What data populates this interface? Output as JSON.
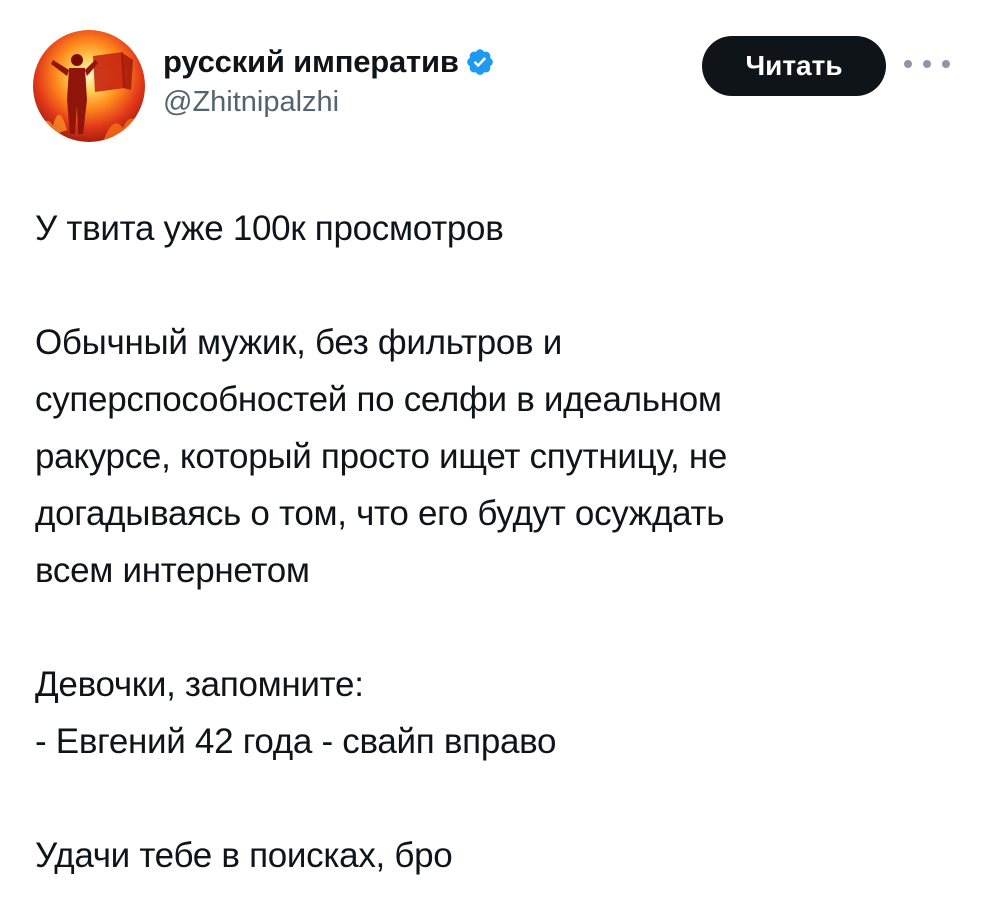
{
  "author": {
    "display_name": "русский императив",
    "handle": "@Zhitnipalzhi",
    "avatar_icon": "avatar-image",
    "verified_icon": "verified-badge-icon",
    "verified_color": "#1d9bf0"
  },
  "actions": {
    "follow_label": "Читать",
    "more_icon": "more-options-icon"
  },
  "tweet": {
    "lines": [
      "У твита уже 100к просмотров",
      "Обычный мужик, без фильтров и",
      "суперспособностей по селфи в идеальном",
      "ракурсе, который просто ищет спутницу, не",
      "догадываясь о том, что его будут осуждать",
      "всем интернетом",
      "Девочки, запомните:",
      "- Евгений 42 года - свайп вправо",
      "Удачи тебе в поисках, бро"
    ]
  },
  "colors": {
    "text": "#0f1419",
    "secondary": "#536471",
    "button_bg": "#0f1419",
    "button_text": "#ffffff"
  }
}
